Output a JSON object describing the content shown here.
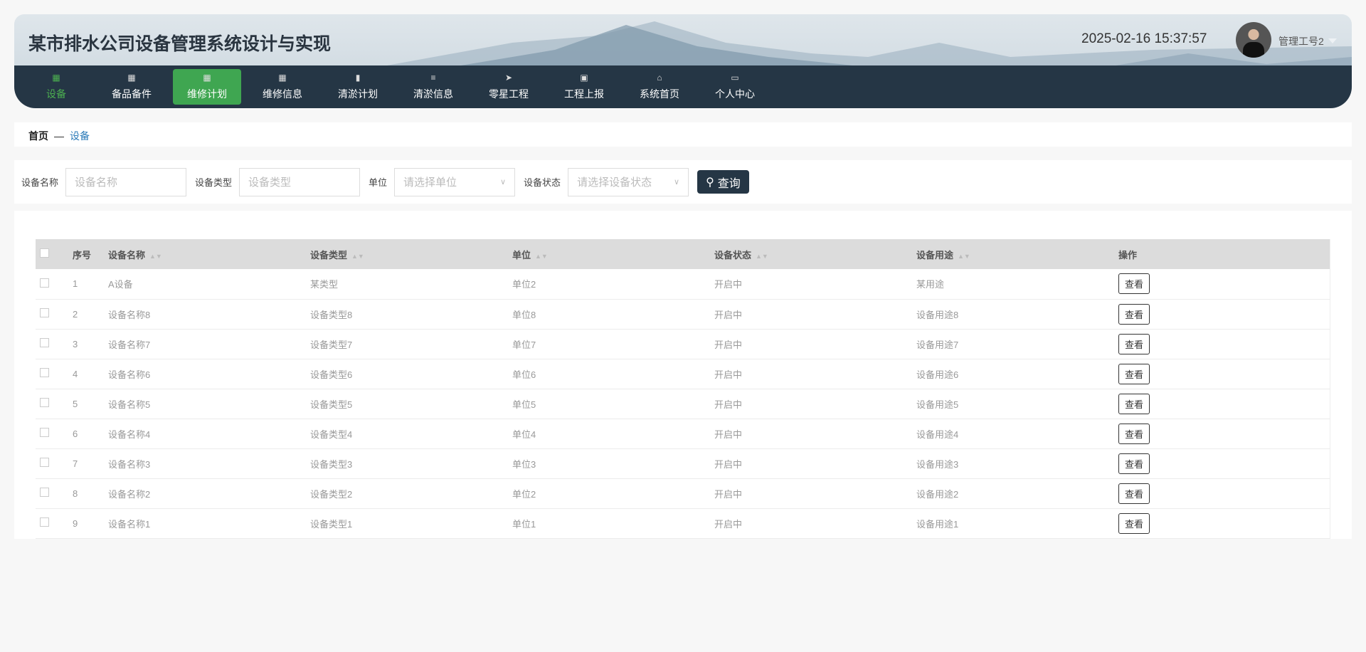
{
  "header": {
    "title": "某市排水公司设备管理系统设计与实现",
    "clock": "2025-02-16 15:37:57",
    "user": "管理工号2"
  },
  "nav": [
    {
      "label": "设备",
      "icon": "grid-icon"
    },
    {
      "label": "备品备件",
      "icon": "grid-icon"
    },
    {
      "label": "维修计划",
      "icon": "grid-icon"
    },
    {
      "label": "维修信息",
      "icon": "grid-icon"
    },
    {
      "label": "清淤计划",
      "icon": "book-icon"
    },
    {
      "label": "清淤信息",
      "icon": "list-icon"
    },
    {
      "label": "零星工程",
      "icon": "send-icon"
    },
    {
      "label": "工程上报",
      "icon": "clipboard-icon"
    },
    {
      "label": "系统首页",
      "icon": "home-icon"
    },
    {
      "label": "个人中心",
      "icon": "wallet-icon"
    }
  ],
  "breadcrumb": {
    "home": "首页",
    "sep": "—",
    "current": "设备"
  },
  "search": {
    "name_label": "设备名称",
    "name_placeholder": "设备名称",
    "type_label": "设备类型",
    "type_placeholder": "设备类型",
    "unit_label": "单位",
    "unit_placeholder": "请选择单位",
    "status_label": "设备状态",
    "status_placeholder": "请选择设备状态",
    "query": "查询"
  },
  "table": {
    "columns": [
      "序号",
      "设备名称",
      "设备类型",
      "单位",
      "设备状态",
      "设备用途",
      "操作"
    ],
    "view_label": "查看",
    "rows": [
      [
        "1",
        "A设备",
        "某类型",
        "单位2",
        "开启中",
        "某用途"
      ],
      [
        "2",
        "设备名称8",
        "设备类型8",
        "单位8",
        "开启中",
        "设备用途8"
      ],
      [
        "3",
        "设备名称7",
        "设备类型7",
        "单位7",
        "开启中",
        "设备用途7"
      ],
      [
        "4",
        "设备名称6",
        "设备类型6",
        "单位6",
        "开启中",
        "设备用途6"
      ],
      [
        "5",
        "设备名称5",
        "设备类型5",
        "单位5",
        "开启中",
        "设备用途5"
      ],
      [
        "6",
        "设备名称4",
        "设备类型4",
        "单位4",
        "开启中",
        "设备用途4"
      ],
      [
        "7",
        "设备名称3",
        "设备类型3",
        "单位3",
        "开启中",
        "设备用途3"
      ],
      [
        "8",
        "设备名称2",
        "设备类型2",
        "单位2",
        "开启中",
        "设备用途2"
      ],
      [
        "9",
        "设备名称1",
        "设备类型1",
        "单位1",
        "开启中",
        "设备用途1"
      ]
    ]
  }
}
